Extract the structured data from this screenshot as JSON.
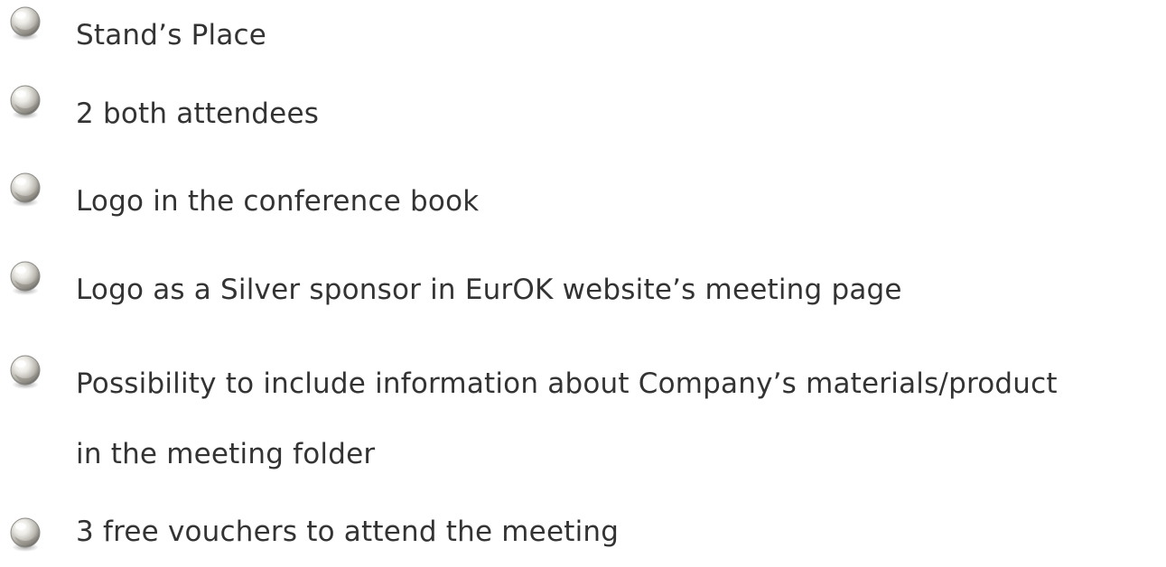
{
  "list": {
    "bullet_icon": "silver-ball-bullet-icon",
    "items": [
      {
        "label": "Stand’s Place"
      },
      {
        "label": "2 both attendees"
      },
      {
        "label": "Logo in the conference book"
      },
      {
        "label": "Logo as a Silver sponsor in EurOK website’s meeting page"
      },
      {
        "label_line1": "Possibility to include information about Company’s materials/product",
        "label_line2": "in the meeting folder"
      },
      {
        "label": "3 free vouchers to attend the meeting"
      }
    ]
  }
}
